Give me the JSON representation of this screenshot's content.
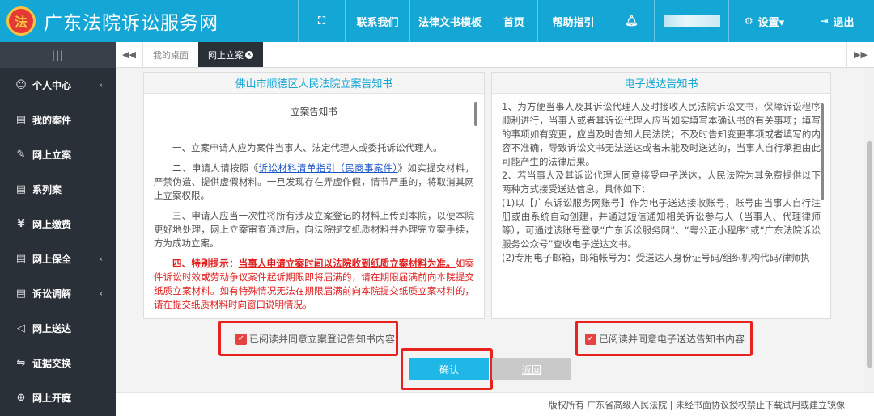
{
  "header": {
    "emblem_text": "法",
    "title": "广东法院诉讼服务网",
    "nav": [
      {
        "icon": "expand-icon",
        "label": ""
      },
      {
        "label": "联系我们"
      },
      {
        "label": "法律文书模板"
      },
      {
        "label": "首页"
      },
      {
        "label": "帮助指引"
      },
      {
        "icon": "bell-icon",
        "label": ""
      },
      {
        "label": "设置▾",
        "icon": "gear-icon"
      },
      {
        "label": "退出",
        "icon": "logout-icon"
      }
    ]
  },
  "sidebar": {
    "toggle": "|||",
    "items": [
      {
        "label": "个人中心",
        "icon": "user-icon",
        "has_caret": true
      },
      {
        "label": "我的案件",
        "icon": "file-icon",
        "has_caret": false
      },
      {
        "label": "网上立案",
        "icon": "edit-icon",
        "has_caret": false
      },
      {
        "label": "系列案",
        "icon": "file-icon",
        "has_caret": false
      },
      {
        "label": "网上缴费",
        "icon": "yen-icon",
        "has_caret": false
      },
      {
        "label": "网上保全",
        "icon": "file-icon",
        "has_caret": true
      },
      {
        "label": "诉讼调解",
        "icon": "file-icon",
        "has_caret": true
      },
      {
        "label": "网上送达",
        "icon": "send-icon",
        "has_caret": false
      },
      {
        "label": "证据交换",
        "icon": "exchange-icon",
        "has_caret": false
      },
      {
        "label": "网上开庭",
        "icon": "globe-icon",
        "has_caret": false
      }
    ]
  },
  "tabs": {
    "items": [
      {
        "label": "我的桌面",
        "active": false
      },
      {
        "label": "网上立案",
        "active": true
      }
    ],
    "close_glyph": "✕"
  },
  "left_panel": {
    "heading": "佛山市顺德区人民法院立案告知书",
    "doc_title": "立案告知书",
    "p1": "一、立案申请人应为案件当事人、法定代理人或委托诉讼代理人。",
    "p2_pre": "二、申请人请按照《",
    "p2_link": "诉讼材料清单指引（民商事案件）",
    "p2_post": "》如实提交材料，严禁伪造、提供虚假材料。一旦发现存在弄虚作假，情节严重的，将取消其网上立案权限。",
    "p3": "三、申请人应当一次性将所有涉及立案登记的材料上传到本院，以便本院更好地处理，网上立案审查通过后，向法院提交纸质材料并办理完立案手续，方为成功立案。",
    "p4_bold": "四、特别提示：",
    "p4_underline": "当事人申请立案时间以法院收到纸质立案材料为准。",
    "p4_rest": "如案件诉讼时效或劳动争议案件起诉期限即将届满的，请在期限届满前向本院提交纸质立案材料。如有特殊情况无法在期限届满前向本院提交纸质立案材料的，请在提交纸质材料时向窗口说明情况。",
    "agree_label": "已阅读并同意立案登记告知书内容"
  },
  "right_panel": {
    "heading": "电子送达告知书",
    "lines": [
      "1、为方便当事人及其诉讼代理人及时接收人民法院诉讼文书，保障诉讼程序顺利进行，当事人或者其诉讼代理人应当如实填写本确认书的有关事项；填写的事项如有变更，应当及时告知人民法院；不及时告知变更事项或者填写的内容不准确，导致诉讼文书无法送达或者未能及时送达的，当事人自行承担由此可能产生的法律后果。",
      "2、若当事人及其诉讼代理人同意接受电子送达，人民法院为其免费提供以下两种方式接受送达信息，具体如下：",
      "(1)以【广东诉讼服务网账号】作为电子送达接收账号，账号由当事人自行注册或由系统自动创建，并通过短信通知相关诉讼参与人（当事人、代理律师等），可通过该账号登录“广东诉讼服务网”、“粤公正小程序”或“广东法院诉讼服务公众号”查收电子送达文书。",
      "(2)专用电子邮箱，邮箱帐号为：受送达人身份证号码/组织机构代码/律师执"
    ],
    "agree_label": "已阅读并同意电子送达告知书内容"
  },
  "buttons": {
    "confirm": "确认",
    "back": "返回"
  },
  "footer": {
    "text": "版权所有 广东省高级人民法院 | 未经书面协议授权禁止下载试用或建立镜像"
  }
}
